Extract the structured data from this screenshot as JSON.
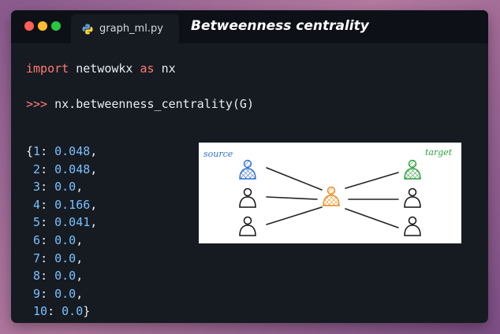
{
  "window": {
    "tab_label": "graph_ml.py",
    "title": "Betweenness centrality"
  },
  "code": {
    "import_kw": "import",
    "module": "netwowkx",
    "as_kw": "as",
    "alias": "nx",
    "prompt": ">>>",
    "call": "nx.betweenness_centrality(G)",
    "results": [
      {
        "key": "1",
        "value": "0.048"
      },
      {
        "key": "2",
        "value": "0.048"
      },
      {
        "key": "3",
        "value": "0.0"
      },
      {
        "key": "4",
        "value": "0.166"
      },
      {
        "key": "5",
        "value": "0.041"
      },
      {
        "key": "6",
        "value": "0.0"
      },
      {
        "key": "7",
        "value": "0.0"
      },
      {
        "key": "8",
        "value": "0.0"
      },
      {
        "key": "9",
        "value": "0.0"
      },
      {
        "key": "10",
        "value": "0.0"
      }
    ]
  },
  "diagram": {
    "source_label": "source",
    "target_label": "target"
  },
  "colors": {
    "source_node": "#2f6fd0",
    "center_node": "#ef8a17",
    "target_node": "#2e9e3e"
  },
  "icons": [
    "python-icon",
    "person-icon"
  ]
}
